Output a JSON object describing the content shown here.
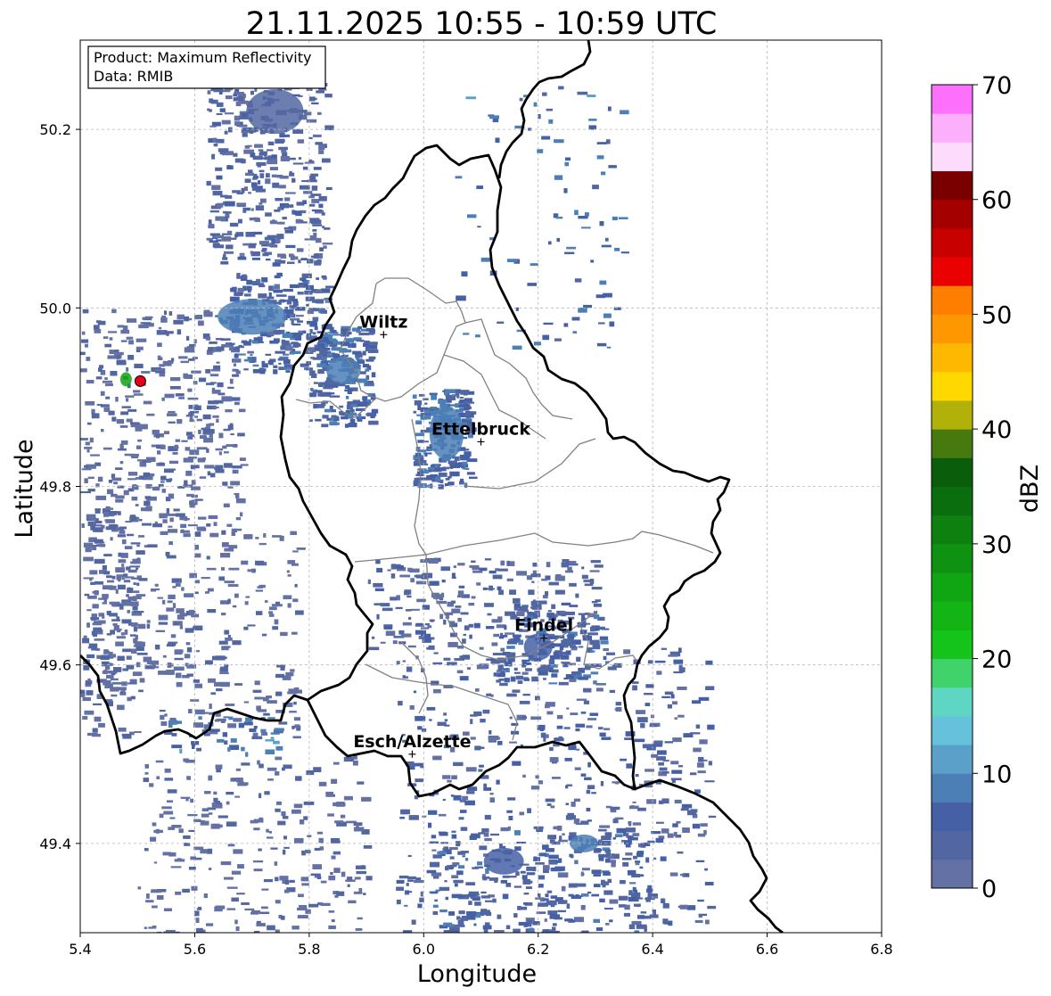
{
  "title": "21.11.2025 10:55 - 10:59 UTC",
  "info_box": {
    "product_line": "Product: Maximum Reflectivity",
    "data_line": "Data: RMIB"
  },
  "axes": {
    "xlabel": "Longitude",
    "ylabel": "Latitude",
    "xlim": [
      5.4,
      6.8
    ],
    "ylim": [
      49.3,
      50.3
    ],
    "x_ticks": [
      5.4,
      5.6,
      5.8,
      6.0,
      6.2,
      6.4,
      6.6,
      6.8
    ],
    "x_tick_labels": [
      "5.4",
      "5.6",
      "5.8",
      "6.0",
      "6.2",
      "6.4",
      "6.6",
      "6.8"
    ],
    "y_ticks": [
      49.4,
      49.6,
      49.8,
      50.0,
      50.2
    ],
    "y_tick_labels": [
      "49.4",
      "49.6",
      "49.8",
      "50.0",
      "50.2"
    ],
    "grid": true
  },
  "cities": [
    {
      "name": "Wiltz",
      "lon": 5.93,
      "lat": 49.97
    },
    {
      "name": "Ettelbruck",
      "lon": 6.1,
      "lat": 49.85
    },
    {
      "name": "Findel",
      "lon": 6.21,
      "lat": 49.63
    },
    {
      "name": "Esch/Alzette",
      "lon": 5.98,
      "lat": 49.5
    }
  ],
  "marker": {
    "lon": 5.505,
    "lat": 49.918,
    "color": "#e8001a"
  },
  "colorbar": {
    "label": "dBZ",
    "min": 0,
    "max": 70,
    "ticks": [
      0,
      10,
      20,
      30,
      40,
      50,
      60,
      70
    ],
    "tick_labels": [
      "0",
      "10",
      "20",
      "30",
      "40",
      "50",
      "60",
      "70"
    ],
    "step": 2.5,
    "colors": [
      "#6471a4",
      "#5266a2",
      "#4660a6",
      "#4b7fb6",
      "#5aa0c8",
      "#66c1da",
      "#5fd6c4",
      "#40d36c",
      "#14c41a",
      "#12b514",
      "#10a512",
      "#0f9212",
      "#0d8010",
      "#0b6e0e",
      "#0a5e0b",
      "#477a0e",
      "#b0b20a",
      "#ffd800",
      "#ffb800",
      "#ff9800",
      "#ff7e00",
      "#ea0000",
      "#c80000",
      "#a40000",
      "#7a0000",
      "#fcdcfc",
      "#fcb0fc",
      "#fc70fc",
      "#ea36ea"
    ]
  },
  "map_colors": {
    "country_border": "#000000",
    "canton_border": "#808080",
    "grid": "#b5b5b5"
  },
  "echo_regions": [
    {
      "lon": [
        5.4,
        5.68
      ],
      "lat": [
        49.75,
        50.0
      ],
      "n": 420,
      "level": 1.8
    },
    {
      "lon": [
        5.4,
        5.5
      ],
      "lat": [
        49.55,
        49.78
      ],
      "n": 160,
      "level": 1.5
    },
    {
      "lon": [
        5.62,
        5.83
      ],
      "lat": [
        50.05,
        50.28
      ],
      "n": 380,
      "level": 3.5
    },
    {
      "lon": [
        5.66,
        5.83
      ],
      "lat": [
        49.93,
        50.04
      ],
      "n": 240,
      "level": 5.0
    },
    {
      "lon": [
        5.8,
        5.91
      ],
      "lat": [
        49.87,
        49.98
      ],
      "n": 200,
      "level": 6.0
    },
    {
      "lon": [
        5.98,
        6.08
      ],
      "lat": [
        49.8,
        49.91
      ],
      "n": 220,
      "level": 6.0
    },
    {
      "lon": [
        5.4,
        5.78
      ],
      "lat": [
        49.52,
        49.75
      ],
      "n": 300,
      "level": 1.5
    },
    {
      "lon": [
        5.5,
        5.9
      ],
      "lat": [
        49.3,
        49.5
      ],
      "n": 260,
      "level": 1.5
    },
    {
      "lon": [
        5.9,
        6.3
      ],
      "lat": [
        49.62,
        49.72
      ],
      "n": 240,
      "level": 3.0
    },
    {
      "lon": [
        5.95,
        6.5
      ],
      "lat": [
        49.3,
        49.62
      ],
      "n": 520,
      "level": 3.5
    },
    {
      "lon": [
        6.12,
        6.32
      ],
      "lat": [
        49.58,
        49.66
      ],
      "n": 130,
      "level": 5.5
    },
    {
      "lon": [
        6.0,
        6.4
      ],
      "lat": [
        49.3,
        49.42
      ],
      "n": 220,
      "level": 5.0
    },
    {
      "lon": [
        6.05,
        6.35
      ],
      "lat": [
        49.95,
        50.25
      ],
      "n": 90,
      "level": 7.5
    },
    {
      "lon": [
        5.55,
        5.75
      ],
      "lat": [
        49.5,
        49.55
      ],
      "n": 40,
      "level": 7.5
    }
  ],
  "rain_patches": [
    {
      "lon": 5.74,
      "lat": 50.22,
      "r": 0.05,
      "rlat": 0.025,
      "level": 4.5
    },
    {
      "lon": 5.7,
      "lat": 49.99,
      "r": 0.06,
      "rlat": 0.02,
      "level": 7.5
    },
    {
      "lon": 5.86,
      "lat": 49.93,
      "r": 0.03,
      "rlat": 0.015,
      "level": 8.5
    },
    {
      "lon": 6.04,
      "lat": 49.86,
      "r": 0.03,
      "rlat": 0.03,
      "level": 8.0
    },
    {
      "lon": 6.2,
      "lat": 49.62,
      "r": 0.025,
      "rlat": 0.015,
      "level": 7.0
    },
    {
      "lon": 6.14,
      "lat": 49.38,
      "r": 0.035,
      "rlat": 0.015,
      "level": 5.5
    },
    {
      "lon": 6.28,
      "lat": 49.4,
      "r": 0.025,
      "rlat": 0.01,
      "level": 8.0
    },
    {
      "lon": 5.48,
      "lat": 49.92,
      "r": 0.01,
      "rlat": 0.008,
      "level": 27.0
    }
  ]
}
